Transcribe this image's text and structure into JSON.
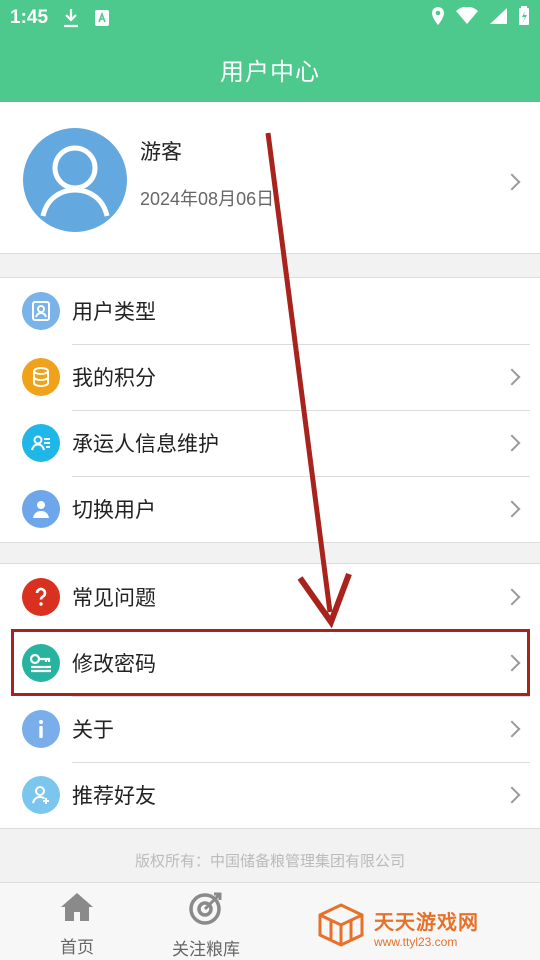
{
  "statusbar": {
    "time": "1:45"
  },
  "header": {
    "title": "用户中心"
  },
  "profile": {
    "name": "游客",
    "date": "2024年08月06日"
  },
  "menu_group1": [
    {
      "label": "用户类型",
      "icon": "user-type-icon",
      "color": "#7ab2ea",
      "chevron": false
    },
    {
      "label": "我的积分",
      "icon": "points-coins-icon",
      "color": "#f0a21a",
      "chevron": true
    },
    {
      "label": "承运人信息维护",
      "icon": "carrier-info-icon",
      "color": "#1fb6e8",
      "chevron": true
    },
    {
      "label": "切换用户",
      "icon": "switch-user-icon",
      "color": "#6ea6ec",
      "chevron": true
    }
  ],
  "menu_group2": [
    {
      "label": "常见问题",
      "icon": "question-icon",
      "color": "#d9301f",
      "chevron": true
    },
    {
      "label": "修改密码",
      "icon": "key-icon",
      "color": "#27b3a0",
      "chevron": true
    },
    {
      "label": "关于",
      "icon": "info-icon",
      "color": "#7aaeea",
      "chevron": true
    },
    {
      "label": "推荐好友",
      "icon": "recommend-friend-icon",
      "color": "#7ac6ee",
      "chevron": true
    }
  ],
  "footer": {
    "copyright": "版权所有：中国储备粮管理集团有限公司"
  },
  "tabbar": {
    "tabs": [
      {
        "label": "首页",
        "icon": "home-icon"
      },
      {
        "label": "关注粮库",
        "icon": "target-icon"
      }
    ]
  },
  "watermark": {
    "title": "天天游戏网",
    "url": "www.ttyl23.com"
  },
  "colors": {
    "primary": "#4dc98e",
    "annotation": "#a8231c"
  }
}
